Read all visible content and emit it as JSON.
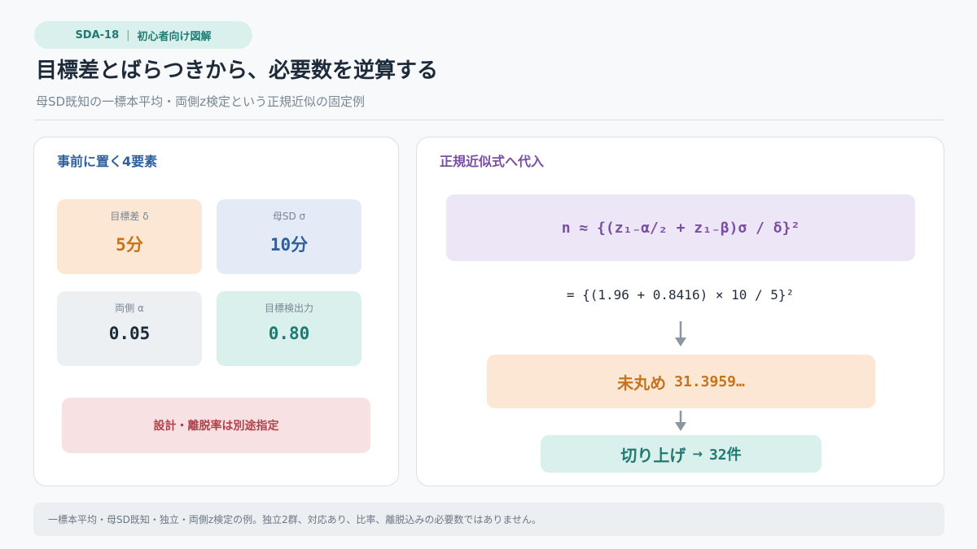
{
  "tag": {
    "code": "SDA-18",
    "separator": "|",
    "label": "初心者向け図解"
  },
  "title": "目標差とばらつきから、必要数を逆算する",
  "subtitle": "母SD既知の一標本平均・両側z検定という正規近似の固定例",
  "left_panel": {
    "title": "事前に置く4要素",
    "cards": [
      {
        "label": "目標差 δ",
        "value": "5分",
        "bg": "#fbe7d3",
        "color": "#c6741c"
      },
      {
        "label": "母SD σ",
        "value": "10分",
        "bg": "#e4ebf7",
        "color": "#2e5f9e"
      },
      {
        "label": "両側 α",
        "value": "0.05",
        "bg": "#edf0f3",
        "color": "#1d2a3a"
      },
      {
        "label": "目標検出力",
        "value": "0.80",
        "bg": "#d9f0ec",
        "color": "#1f7a74"
      }
    ],
    "note": "設計・離脱率は別途指定"
  },
  "right_panel": {
    "title": "正規近似式へ代入",
    "formula": "n ≈ {(z₁₋α/₂ + z₁₋β)σ / δ}²",
    "substitution": "= {(1.96 + 0.8416) × 10 / 5}²",
    "unrounded_label": "未丸め",
    "unrounded_value": "31.3959…",
    "rounded_label": "切り上げ",
    "rounded_arrow": "→",
    "rounded_value": "32件"
  },
  "footer": "一標本平均・母SD既知・独立・両側z検定の例。独立2群、対応あり、比率、離脱込みの必要数ではありません。",
  "icons": {
    "flow_arrow": "arrow-down-icon"
  },
  "colors": {
    "accent_teal": "#1f7a74",
    "accent_purple": "#7a4fa3",
    "accent_orange": "#c6741c",
    "accent_blue": "#2e5f9e",
    "arrow": "#8a97a3"
  }
}
